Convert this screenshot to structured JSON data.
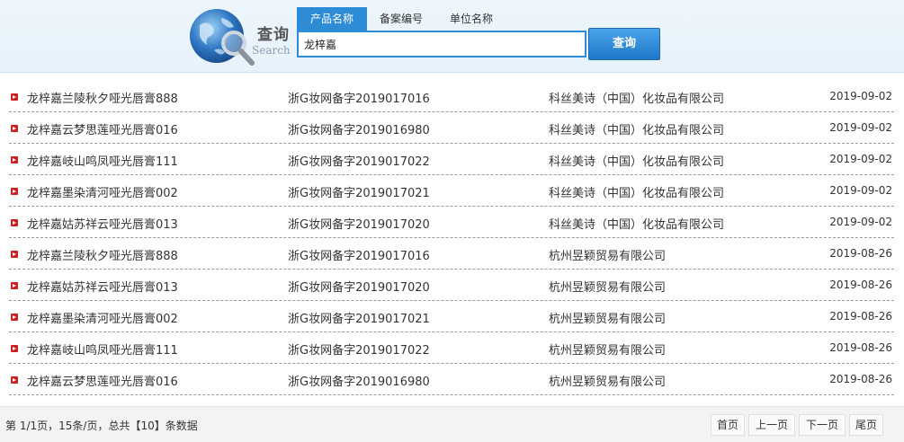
{
  "header": {
    "logo_cn": "查询",
    "logo_en": "Search",
    "tabs": [
      {
        "label": "产品名称"
      },
      {
        "label": "备案编号"
      },
      {
        "label": "单位名称"
      }
    ],
    "search_value": "龙梓嘉",
    "search_button": "查询"
  },
  "results": [
    {
      "name": "龙梓嘉兰陵秋夕哑光唇膏888",
      "record": "浙G妆网备字2019017016",
      "company": "科丝美诗（中国）化妆品有限公司",
      "date": "2019-09-02"
    },
    {
      "name": "龙梓嘉云梦思莲哑光唇膏016",
      "record": "浙G妆网备字2019016980",
      "company": "科丝美诗（中国）化妆品有限公司",
      "date": "2019-09-02"
    },
    {
      "name": "龙梓嘉岐山鸣凤哑光唇膏111",
      "record": "浙G妆网备字2019017022",
      "company": "科丝美诗（中国）化妆品有限公司",
      "date": "2019-09-02"
    },
    {
      "name": "龙梓嘉墨染清河哑光唇膏002",
      "record": "浙G妆网备字2019017021",
      "company": "科丝美诗（中国）化妆品有限公司",
      "date": "2019-09-02"
    },
    {
      "name": "龙梓嘉姑苏祥云哑光唇膏013",
      "record": "浙G妆网备字2019017020",
      "company": "科丝美诗（中国）化妆品有限公司",
      "date": "2019-09-02"
    },
    {
      "name": "龙梓嘉兰陵秋夕哑光唇膏888",
      "record": "浙G妆网备字2019017016",
      "company": "杭州昱颖贸易有限公司",
      "date": "2019-08-26"
    },
    {
      "name": "龙梓嘉姑苏祥云哑光唇膏013",
      "record": "浙G妆网备字2019017020",
      "company": "杭州昱颖贸易有限公司",
      "date": "2019-08-26"
    },
    {
      "name": "龙梓嘉墨染清河哑光唇膏002",
      "record": "浙G妆网备字2019017021",
      "company": "杭州昱颖贸易有限公司",
      "date": "2019-08-26"
    },
    {
      "name": "龙梓嘉岐山鸣凤哑光唇膏111",
      "record": "浙G妆网备字2019017022",
      "company": "杭州昱颖贸易有限公司",
      "date": "2019-08-26"
    },
    {
      "name": "龙梓嘉云梦思莲哑光唇膏016",
      "record": "浙G妆网备字2019016980",
      "company": "杭州昱颖贸易有限公司",
      "date": "2019-08-26"
    }
  ],
  "footer": {
    "page_info": "第 1/1页，15条/页，总共【10】条数据",
    "first": "首页",
    "prev": "上一页",
    "next": "下一页",
    "last": "尾页"
  },
  "colors": {
    "accent": "#2e8bd6",
    "bullet": "#cc1f1f"
  }
}
